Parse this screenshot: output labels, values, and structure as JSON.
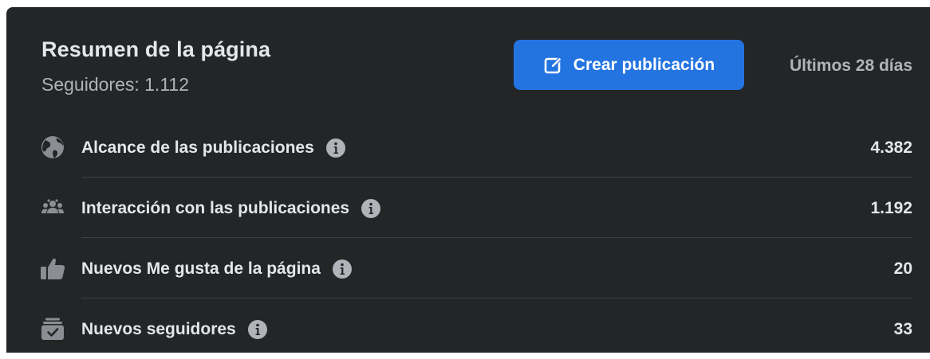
{
  "summary": {
    "title": "Resumen de la página",
    "followers": "Seguidores: 1.112",
    "create_post_label": "Crear publicación",
    "period": "Últimos 28 días"
  },
  "metrics": [
    {
      "label": "Alcance de las publicaciones",
      "value": "4.382",
      "icon": "globe-icon"
    },
    {
      "label": "Interacción con las publicaciones",
      "value": "1.192",
      "icon": "people-group-icon"
    },
    {
      "label": "Nuevos Me gusta de la página",
      "value": "20",
      "icon": "thumbs-up-icon"
    },
    {
      "label": "Nuevos seguidores",
      "value": "33",
      "icon": "follow-box-icon"
    }
  ],
  "colors": {
    "card_background": "#242526",
    "primary_text": "#e4e6eb",
    "secondary_text": "#b0b3b8",
    "accent_button": "#2374e1",
    "icon_gray": "#8a8d91",
    "divider": "#3e4042"
  }
}
